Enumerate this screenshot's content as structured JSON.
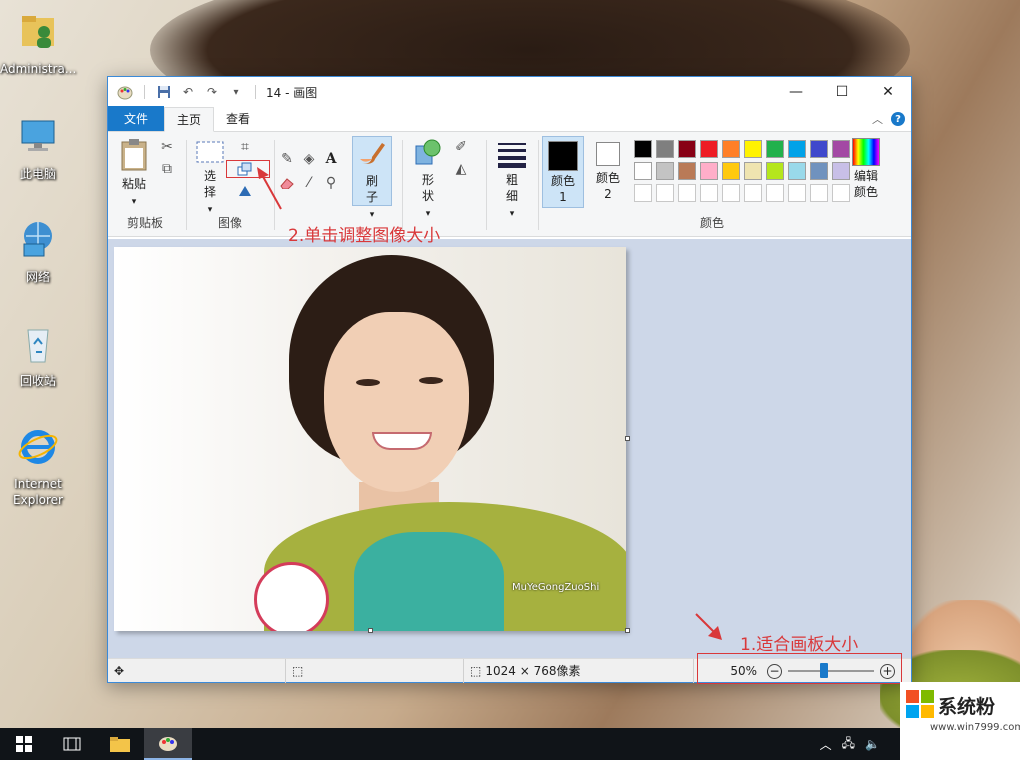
{
  "desktop": {
    "icons": [
      {
        "label": "Administra..."
      },
      {
        "label": "此电脑"
      },
      {
        "label": "网络"
      },
      {
        "label": "回收站"
      },
      {
        "label": "Internet Explorer"
      }
    ]
  },
  "window": {
    "title": "14 - 画图",
    "tabs": {
      "file": "文件",
      "home": "主页",
      "view": "查看"
    },
    "ribbon": {
      "clipboard": {
        "paste": "粘贴",
        "group": "剪贴板"
      },
      "image": {
        "select": "选择",
        "group": "图像"
      },
      "tools": {
        "brush": "刷子"
      },
      "shapes": {
        "shape": "形状"
      },
      "size": {
        "label": "粗细"
      },
      "colors": {
        "color1": "颜色 1",
        "color2": "颜色 2",
        "edit": "编辑颜色",
        "group": "颜色",
        "palette_row1": [
          "#000000",
          "#7f7f7f",
          "#880015",
          "#ed1c24",
          "#ff7f27",
          "#fff200",
          "#22b14c",
          "#00a2e8",
          "#3f48cc",
          "#a349a4"
        ],
        "palette_row2": [
          "#ffffff",
          "#c3c3c3",
          "#b97a57",
          "#ffaec9",
          "#ffc90e",
          "#efe4b0",
          "#b5e61d",
          "#99d9ea",
          "#7092be",
          "#c8bfe7"
        ]
      }
    },
    "statusbar": {
      "dimensions": "1024 × 768像素",
      "zoom_level": "50%",
      "zoom_fraction": 0.42
    },
    "canvas": {
      "watermark": "MuYeGongZuoShi"
    }
  },
  "annotations": {
    "step2": "2.单击调整图像大小",
    "step1": "1.适合画板大小"
  },
  "brand": {
    "name": "系统粉",
    "url": "www.win7999.com"
  }
}
